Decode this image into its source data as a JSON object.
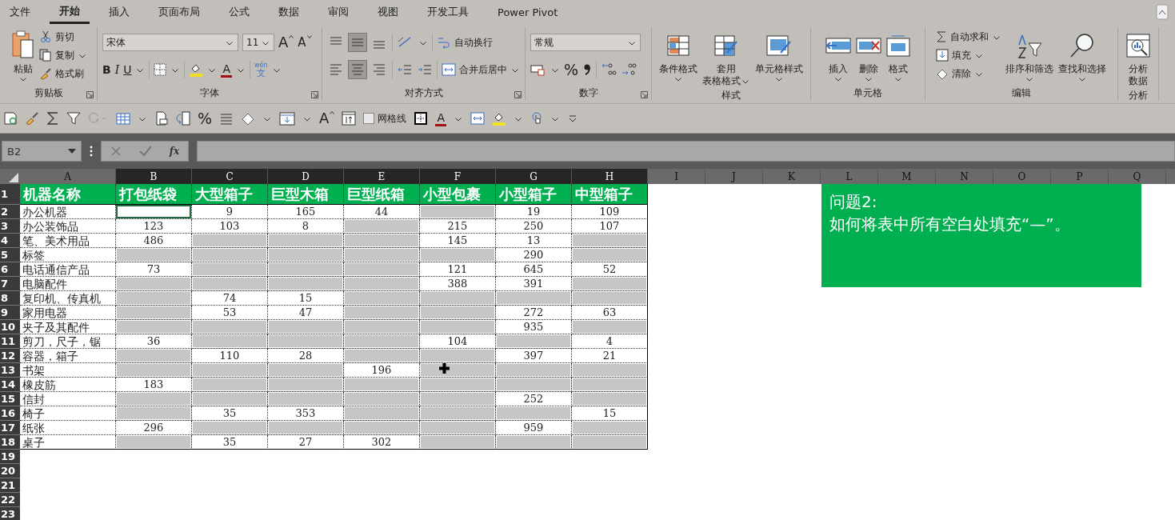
{
  "ribbon": {
    "tabs": [
      {
        "label": "文件",
        "selected": false
      },
      {
        "label": "开始",
        "selected": true
      },
      {
        "label": "插入",
        "selected": false
      },
      {
        "label": "页面布局",
        "selected": false
      },
      {
        "label": "公式",
        "selected": false
      },
      {
        "label": "数据",
        "selected": false
      },
      {
        "label": "审阅",
        "selected": false
      },
      {
        "label": "视图",
        "selected": false
      },
      {
        "label": "开发工具",
        "selected": false
      },
      {
        "label": "Power Pivot",
        "selected": false
      }
    ],
    "clipboard": {
      "label": "剪贴板",
      "paste": "粘贴",
      "cut": "剪切",
      "copy": "复制",
      "format_painter": "格式刷"
    },
    "font": {
      "label": "字体",
      "name": "宋体",
      "size": "11",
      "grow": "A",
      "shrink": "A",
      "bold": "B",
      "italic": "I",
      "underline": "U",
      "font_color": "A",
      "phonetic_top": "wén",
      "phonetic_bottom": "文"
    },
    "alignment": {
      "label": "对齐方式",
      "wrap_text": "自动换行",
      "merge_center": "合并后居中"
    },
    "number": {
      "label": "数字",
      "format": "常规",
      "percent": "%"
    },
    "styles": {
      "label": "样式",
      "conditional": "条件格式",
      "table_format": [
        "套用",
        "表格格式"
      ],
      "cell_styles": "单元格样式"
    },
    "cells": {
      "label": "单元格",
      "insert": "插入",
      "delete": "删除",
      "format": "格式"
    },
    "editing": {
      "label": "编辑",
      "autosum": "自动求和",
      "fill": "填充",
      "clear": "清除",
      "sort_filter": "排序和筛选",
      "find_select": "查找和选择"
    },
    "analysis": {
      "label": "分析",
      "analyze": [
        "分析",
        "数据"
      ]
    }
  },
  "quick_access": {
    "percent": "%",
    "grow_font": "A",
    "font_color": "A",
    "gridlines": {
      "label": "网格线",
      "checked": false
    }
  },
  "formula_bar": {
    "name_box": "B2",
    "function_button": "fx"
  },
  "sheet": {
    "columns": [
      {
        "label": "A",
        "selected": false
      },
      {
        "label": "B",
        "selected": true
      },
      {
        "label": "C",
        "selected": true
      },
      {
        "label": "D",
        "selected": true
      },
      {
        "label": "E",
        "selected": true
      },
      {
        "label": "F",
        "selected": true
      },
      {
        "label": "G",
        "selected": true
      },
      {
        "label": "H",
        "selected": true
      },
      {
        "label": "I",
        "selected": false
      },
      {
        "label": "J",
        "selected": false
      },
      {
        "label": "K",
        "selected": false
      },
      {
        "label": "L",
        "selected": false
      },
      {
        "label": "M",
        "selected": false
      },
      {
        "label": "N",
        "selected": false
      },
      {
        "label": "O",
        "selected": false
      },
      {
        "label": "P",
        "selected": false
      },
      {
        "label": "Q",
        "selected": false
      }
    ],
    "header": {
      "row": "1",
      "cells": [
        "机器名称",
        "打包纸袋",
        "大型箱子",
        "巨型木箱",
        "巨型纸箱",
        "小型包裹",
        "小型箱子",
        "中型箱子"
      ]
    },
    "rows": [
      {
        "row": "2",
        "cells": [
          {
            "value": "办公机器",
            "selected": false,
            "active": false
          },
          {
            "selected": false,
            "active": true
          },
          {
            "value": "9",
            "selected": false,
            "active": false
          },
          {
            "value": "165",
            "selected": false,
            "active": false
          },
          {
            "value": "44",
            "selected": false,
            "active": false
          },
          {
            "selected": true,
            "active": false
          },
          {
            "value": "19",
            "selected": false,
            "active": false
          },
          {
            "value": "109",
            "selected": false,
            "active": false
          }
        ]
      },
      {
        "row": "3",
        "cells": [
          {
            "value": "办公装饰品",
            "selected": false,
            "active": false
          },
          {
            "value": "123",
            "selected": false,
            "active": false
          },
          {
            "value": "103",
            "selected": false,
            "active": false
          },
          {
            "value": "8",
            "selected": false,
            "active": false
          },
          {
            "selected": true,
            "active": false
          },
          {
            "value": "215",
            "selected": false,
            "active": false
          },
          {
            "value": "250",
            "selected": false,
            "active": false
          },
          {
            "value": "107",
            "selected": false,
            "active": false
          }
        ]
      },
      {
        "row": "4",
        "cells": [
          {
            "value": "笔、美术用品",
            "selected": false,
            "active": false
          },
          {
            "value": "486",
            "selected": false,
            "active": false
          },
          {
            "selected": true,
            "active": false
          },
          {
            "selected": true,
            "active": false
          },
          {
            "selected": true,
            "active": false
          },
          {
            "value": "145",
            "selected": false,
            "active": false
          },
          {
            "value": "13",
            "selected": false,
            "active": false
          },
          {
            "selected": true,
            "active": false
          }
        ]
      },
      {
        "row": "5",
        "cells": [
          {
            "value": "标签",
            "selected": false,
            "active": false
          },
          {
            "selected": true,
            "active": false
          },
          {
            "selected": true,
            "active": false
          },
          {
            "selected": true,
            "active": false
          },
          {
            "selected": true,
            "active": false
          },
          {
            "selected": true,
            "active": false
          },
          {
            "value": "290",
            "selected": false,
            "active": false
          },
          {
            "selected": true,
            "active": false
          }
        ]
      },
      {
        "row": "6",
        "cells": [
          {
            "value": "电话通信产品",
            "selected": false,
            "active": false
          },
          {
            "value": "73",
            "selected": false,
            "active": false
          },
          {
            "selected": true,
            "active": false
          },
          {
            "selected": true,
            "active": false
          },
          {
            "selected": true,
            "active": false
          },
          {
            "value": "121",
            "selected": false,
            "active": false
          },
          {
            "value": "645",
            "selected": false,
            "active": false
          },
          {
            "value": "52",
            "selected": false,
            "active": false
          }
        ]
      },
      {
        "row": "7",
        "cells": [
          {
            "value": "电脑配件",
            "selected": false,
            "active": false
          },
          {
            "selected": true,
            "active": false
          },
          {
            "selected": true,
            "active": false
          },
          {
            "selected": true,
            "active": false
          },
          {
            "selected": true,
            "active": false
          },
          {
            "value": "388",
            "selected": false,
            "active": false
          },
          {
            "value": "391",
            "selected": false,
            "active": false
          },
          {
            "selected": true,
            "active": false
          }
        ]
      },
      {
        "row": "8",
        "cells": [
          {
            "value": "复印机、传真机",
            "selected": false,
            "active": false
          },
          {
            "selected": true,
            "active": false
          },
          {
            "value": "74",
            "selected": false,
            "active": false
          },
          {
            "value": "15",
            "selected": false,
            "active": false
          },
          {
            "selected": true,
            "active": false
          },
          {
            "selected": true,
            "active": false
          },
          {
            "selected": true,
            "active": false
          },
          {
            "selected": true,
            "active": false
          }
        ]
      },
      {
        "row": "9",
        "cells": [
          {
            "value": "家用电器",
            "selected": false,
            "active": false
          },
          {
            "selected": true,
            "active": false
          },
          {
            "value": "53",
            "selected": false,
            "active": false
          },
          {
            "value": "47",
            "selected": false,
            "active": false
          },
          {
            "selected": true,
            "active": false
          },
          {
            "selected": true,
            "active": false
          },
          {
            "value": "272",
            "selected": false,
            "active": false
          },
          {
            "value": "63",
            "selected": false,
            "active": false
          }
        ]
      },
      {
        "row": "10",
        "cells": [
          {
            "value": "夹子及其配件",
            "selected": false,
            "active": false
          },
          {
            "selected": true,
            "active": false
          },
          {
            "selected": true,
            "active": false
          },
          {
            "selected": true,
            "active": false
          },
          {
            "selected": true,
            "active": false
          },
          {
            "selected": true,
            "active": false
          },
          {
            "value": "935",
            "selected": false,
            "active": false
          },
          {
            "selected": true,
            "active": false
          }
        ]
      },
      {
        "row": "11",
        "cells": [
          {
            "value": "剪刀，尺子，锯",
            "selected": false,
            "active": false
          },
          {
            "value": "36",
            "selected": false,
            "active": false
          },
          {
            "selected": true,
            "active": false
          },
          {
            "selected": true,
            "active": false
          },
          {
            "selected": true,
            "active": false
          },
          {
            "value": "104",
            "selected": false,
            "active": false
          },
          {
            "selected": true,
            "active": false
          },
          {
            "value": "4",
            "selected": false,
            "active": false
          }
        ]
      },
      {
        "row": "12",
        "cells": [
          {
            "value": "容器，箱子",
            "selected": false,
            "active": false
          },
          {
            "selected": true,
            "active": false
          },
          {
            "value": "110",
            "selected": false,
            "active": false
          },
          {
            "value": "28",
            "selected": false,
            "active": false
          },
          {
            "selected": true,
            "active": false
          },
          {
            "selected": true,
            "active": false
          },
          {
            "value": "397",
            "selected": false,
            "active": false
          },
          {
            "value": "21",
            "selected": false,
            "active": false
          }
        ]
      },
      {
        "row": "13",
        "cells": [
          {
            "value": "书架",
            "selected": false,
            "active": false
          },
          {
            "selected": true,
            "active": false
          },
          {
            "selected": true,
            "active": false
          },
          {
            "selected": true,
            "active": false
          },
          {
            "value": "196",
            "selected": false,
            "active": false
          },
          {
            "selected": true,
            "active": false
          },
          {
            "selected": true,
            "active": false
          },
          {
            "selected": true,
            "active": false
          }
        ]
      },
      {
        "row": "14",
        "cells": [
          {
            "value": "橡皮筋",
            "selected": false,
            "active": false
          },
          {
            "value": "183",
            "selected": false,
            "active": false
          },
          {
            "selected": true,
            "active": false
          },
          {
            "selected": true,
            "active": false
          },
          {
            "selected": true,
            "active": false
          },
          {
            "selected": true,
            "active": false
          },
          {
            "selected": true,
            "active": false
          },
          {
            "selected": true,
            "active": false
          }
        ]
      },
      {
        "row": "15",
        "cells": [
          {
            "value": "信封",
            "selected": false,
            "active": false
          },
          {
            "selected": true,
            "active": false
          },
          {
            "selected": true,
            "active": false
          },
          {
            "selected": true,
            "active": false
          },
          {
            "selected": true,
            "active": false
          },
          {
            "selected": true,
            "active": false
          },
          {
            "value": "252",
            "selected": false,
            "active": false
          },
          {
            "selected": true,
            "active": false
          }
        ]
      },
      {
        "row": "16",
        "cells": [
          {
            "value": "椅子",
            "selected": false,
            "active": false
          },
          {
            "selected": true,
            "active": false
          },
          {
            "value": "35",
            "selected": false,
            "active": false
          },
          {
            "value": "353",
            "selected": false,
            "active": false
          },
          {
            "selected": true,
            "active": false
          },
          {
            "selected": true,
            "active": false
          },
          {
            "selected": true,
            "active": false
          },
          {
            "value": "15",
            "selected": false,
            "active": false
          }
        ]
      },
      {
        "row": "17",
        "cells": [
          {
            "value": "纸张",
            "selected": false,
            "active": false
          },
          {
            "value": "296",
            "selected": false,
            "active": false
          },
          {
            "selected": true,
            "active": false
          },
          {
            "selected": true,
            "active": false
          },
          {
            "selected": true,
            "active": false
          },
          {
            "selected": true,
            "active": false
          },
          {
            "value": "959",
            "selected": false,
            "active": false
          },
          {
            "selected": true,
            "active": false
          }
        ]
      },
      {
        "row": "18",
        "cells": [
          {
            "value": "桌子",
            "selected": false,
            "active": false
          },
          {
            "selected": true,
            "active": false
          },
          {
            "value": "35",
            "selected": false,
            "active": false
          },
          {
            "value": "27",
            "selected": false,
            "active": false
          },
          {
            "value": "302",
            "selected": false,
            "active": false
          },
          {
            "selected": true,
            "active": false
          },
          {
            "selected": true,
            "active": false
          },
          {
            "selected": true,
            "active": false
          }
        ]
      }
    ],
    "empty_rows": [
      "19",
      "20",
      "21",
      "22",
      "23"
    ],
    "text_box": {
      "title": "问题2:",
      "body": "如何将表中所有空白处填充“—”。"
    }
  }
}
